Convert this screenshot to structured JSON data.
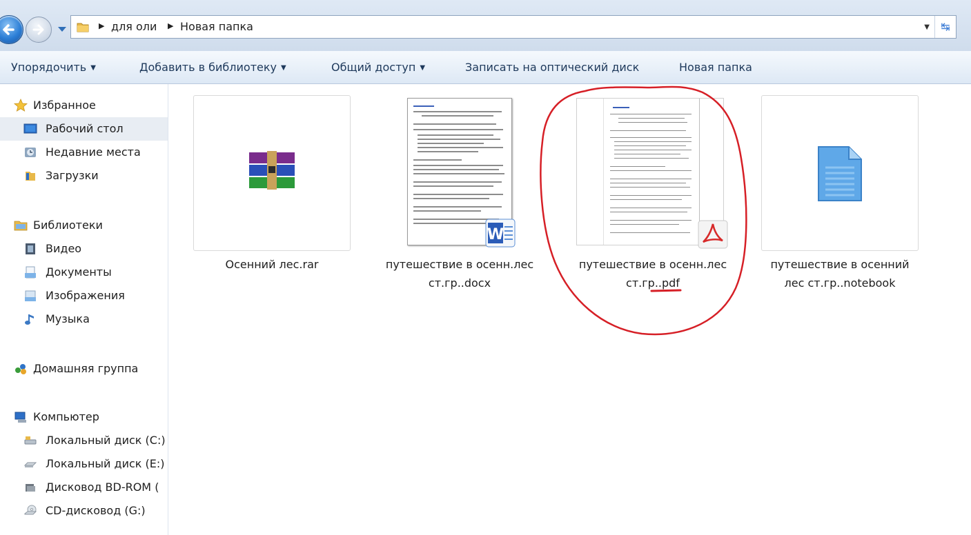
{
  "address": {
    "crumbs": [
      "для оли",
      "Новая папка"
    ]
  },
  "toolbar": {
    "organize": "Упорядочить",
    "add_library": "Добавить в библиотеку",
    "share": "Общий доступ",
    "burn": "Записать на оптический диск",
    "new_folder": "Новая папка"
  },
  "nav": {
    "favorites": "Избранное",
    "desktop": "Рабочий стол",
    "recent": "Недавние места",
    "downloads": "Загрузки",
    "libraries": "Библиотеки",
    "video": "Видео",
    "documents": "Документы",
    "images": "Изображения",
    "music": "Музыка",
    "homegroup": "Домашняя группа",
    "computer": "Компьютер",
    "drive_c": "Локальный диск (C:)",
    "drive_e": "Локальный диск (E:)",
    "bd_rom": "Дисковод BD-ROM (",
    "cd_drive": "CD-дисковод (G:)"
  },
  "files": {
    "rar": {
      "line1": "Осенний лес.rar",
      "line2": "",
      "icon": "winrar-archive-icon"
    },
    "docx": {
      "line1": "путешествие в осенн.лес",
      "line2": "ст.гр..docx",
      "icon": "word-icon"
    },
    "pdf": {
      "line1": "путешествие в осенн.лес",
      "line2": "ст.гр..pdf",
      "icon": "pdf-icon"
    },
    "notebook": {
      "line1": "путешествие в осенний",
      "line2": "лес ст.гр..notebook",
      "icon": "generic-file-icon"
    }
  },
  "colors": {
    "annotation": "#d61f26",
    "toolbar_text": "#1e395b",
    "selected_nav_bg": "#e8edf3"
  }
}
